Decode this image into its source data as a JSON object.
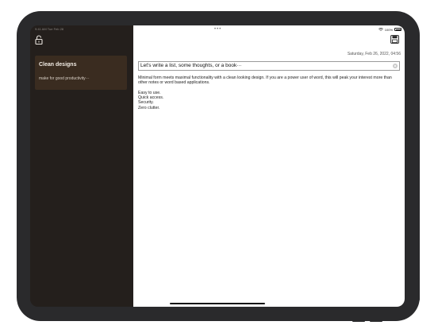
{
  "status_bar": {
    "time_date": "9:41 AM  Tue Feb 28",
    "wifi_icon": "wifi-icon",
    "battery_percent": "100%",
    "battery_level": 1.0
  },
  "sidebar": {
    "lock_icon": "lock-open-icon",
    "notes": [
      {
        "title": "Clean designs",
        "preview": "make for good productivity···"
      }
    ],
    "background": "#241f1c",
    "selected_background": "#3a2c20"
  },
  "editor": {
    "top_dots": "•••",
    "save_icon": "save-icon",
    "date": "Saturday, Feb 26, 2022, 04:56",
    "title_placeholder": "Let's write a list, some thoughts, or a book···",
    "title_value": "",
    "clear_icon": "clear-circle-icon",
    "paragraph": "Minimal form meets maximal functionality with a clean looking design. If you are a power user of word, this will peak your interest more than other notes or word based applications.",
    "list": [
      "Easy to use.",
      "Quick access.",
      "Security.",
      "Zero clutter."
    ]
  }
}
